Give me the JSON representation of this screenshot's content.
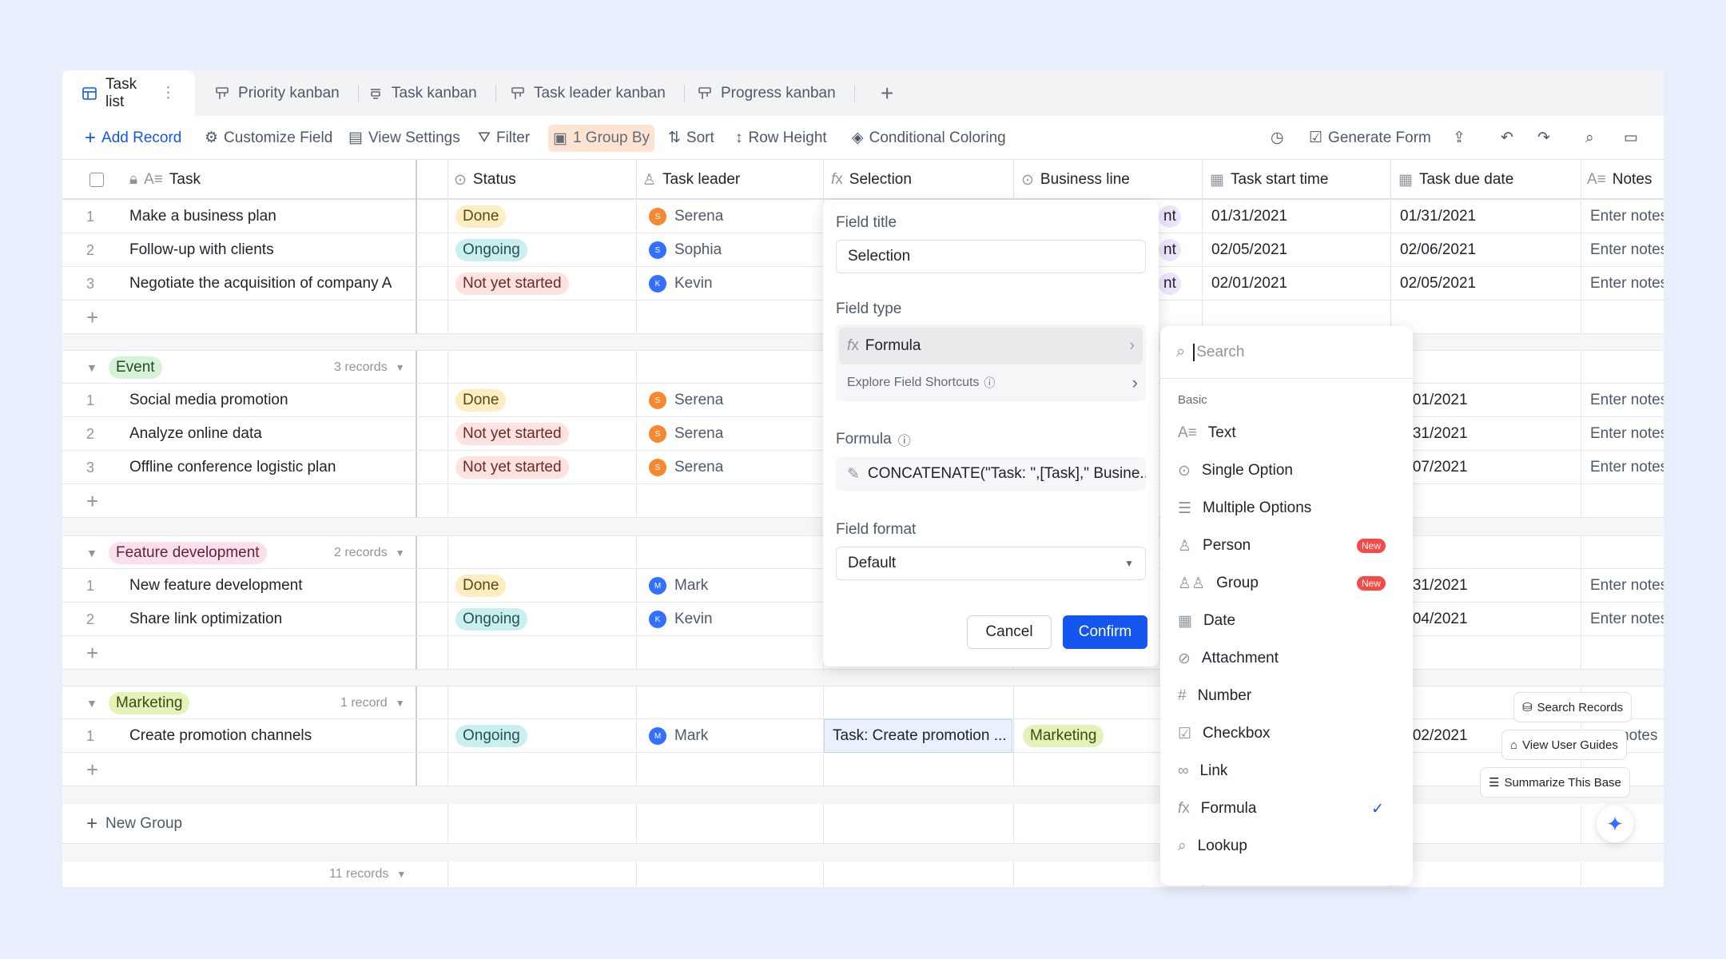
{
  "tabs": [
    {
      "label": "Task list",
      "icon": "grid-icon"
    },
    {
      "label": "Priority kanban",
      "icon": "kanban-icon"
    },
    {
      "label": "Task kanban",
      "icon": "kanban-icon"
    },
    {
      "label": "Task leader kanban",
      "icon": "kanban-icon"
    },
    {
      "label": "Progress kanban",
      "icon": "kanban-icon"
    }
  ],
  "toolbar": {
    "add_record": "Add Record",
    "customize_field": "Customize Field",
    "view_settings": "View Settings",
    "filter": "Filter",
    "group_by": "1 Group By",
    "sort": "Sort",
    "row_height": "Row Height",
    "conditional_coloring": "Conditional Coloring",
    "generate_form": "Generate Form"
  },
  "columns": {
    "task": "Task",
    "status": "Status",
    "task_leader": "Task leader",
    "selection": "Selection",
    "business_line": "Business line",
    "task_start_time": "Task start time",
    "task_due_date": "Task due date",
    "notes": "Notes"
  },
  "rows_top": [
    {
      "num": "1",
      "task": "Make a business plan",
      "status": "Done",
      "leader": "Serena",
      "leader_initial": "S",
      "bl": "nt",
      "start": "01/31/2021",
      "due": "01/31/2021",
      "notes": "Enter notes"
    },
    {
      "num": "2",
      "task": "Follow-up with clients",
      "status": "Ongoing",
      "leader": "Sophia",
      "leader_initial": "S",
      "bl": "nt",
      "start": "02/05/2021",
      "due": "02/06/2021",
      "notes": "Enter notes"
    },
    {
      "num": "3",
      "task": "Negotiate the acquisition of company A",
      "status": "Not yet started",
      "leader": "Kevin",
      "leader_initial": "K",
      "bl": "nt",
      "start": "02/01/2021",
      "due": "02/05/2021",
      "notes": "Enter notes"
    }
  ],
  "groups": {
    "event": {
      "name": "Event",
      "count": "3 records",
      "rows": [
        {
          "num": "1",
          "task": "Social media promotion",
          "status": "Done",
          "leader": "Serena",
          "leader_initial": "S",
          "due": "2/01/2021",
          "notes": "Enter notes"
        },
        {
          "num": "2",
          "task": "Analyze online data",
          "status": "Not yet started",
          "leader": "Serena",
          "leader_initial": "S",
          "due": "1/31/2021",
          "notes": "Enter notes"
        },
        {
          "num": "3",
          "task": "Offline conference logistic plan",
          "status": "Not yet started",
          "leader": "Serena",
          "leader_initial": "S",
          "due": "2/07/2021",
          "notes": "Enter notes"
        }
      ]
    },
    "feature": {
      "name": "Feature development",
      "count": "2 records",
      "rows": [
        {
          "num": "1",
          "task": "New feature development",
          "status": "Done",
          "leader": "Mark",
          "leader_initial": "M",
          "due": "1/31/2021",
          "notes": "Enter notes"
        },
        {
          "num": "2",
          "task": "Share link optimization",
          "status": "Ongoing",
          "leader": "Kevin",
          "leader_initial": "K",
          "due": "2/04/2021",
          "notes": "Enter notes"
        }
      ]
    },
    "marketing": {
      "name": "Marketing",
      "count": "1 record",
      "rows": [
        {
          "num": "1",
          "task": "Create promotion channels",
          "status": "Ongoing",
          "leader": "Mark",
          "leader_initial": "M",
          "selection": "Task: Create promotion ...",
          "bl": "Marketing",
          "due": "2/02/2021",
          "notes": "notes"
        }
      ]
    }
  },
  "new_group": "New Group",
  "total_records": "11 records",
  "field_panel": {
    "field_title_label": "Field title",
    "field_title_value": "Selection",
    "field_type_label": "Field type",
    "field_type_value": "Formula",
    "explore": "Explore Field Shortcuts",
    "formula_label": "Formula",
    "formula_value": "CONCATENATE(\"Task: \",[Task],\" Busine...",
    "format_label": "Field format",
    "format_value": "Default",
    "cancel": "Cancel",
    "confirm": "Confirm"
  },
  "type_dropdown": {
    "search_placeholder": "Search",
    "section": "Basic",
    "new_badge": "New",
    "items": [
      "Text",
      "Single Option",
      "Multiple Options",
      "Person",
      "Group",
      "Date",
      "Attachment",
      "Number",
      "Checkbox",
      "Link",
      "Formula",
      "Lookup"
    ]
  },
  "float_buttons": {
    "search_records": "Search Records",
    "view_user_guides": "View User Guides",
    "summarize": "Summarize This Base"
  },
  "colors": {
    "accent": "#1456f0",
    "done": "#fdeec2",
    "ongoing": "#c9f0ee",
    "not_started": "#fde2e0",
    "serena": "#f7882f",
    "sophia": "#3370ff",
    "kevin": "#3370ff",
    "mark": "#3370ff"
  }
}
